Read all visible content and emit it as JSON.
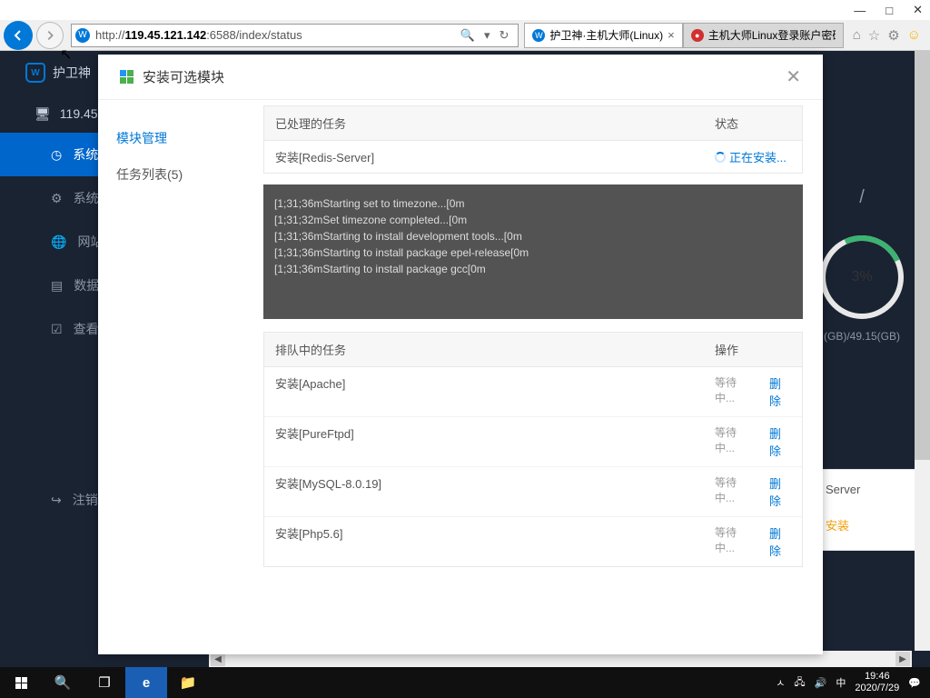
{
  "window": {
    "minimize": "—",
    "maximize": "□",
    "close": "✕"
  },
  "nav": {
    "url_prefix": "http://",
    "url_host": "119.45.121.142",
    "url_rest": ":6588/index/status",
    "search": "🔍",
    "dropdown": "▾",
    "refresh": "↻"
  },
  "tabs": [
    {
      "icon_bg": "#0078d7",
      "icon": "W",
      "label": "护卫神·主机大师(Linux)",
      "close": "×"
    },
    {
      "icon_bg": "#d32f2f",
      "icon": "●",
      "label": "主机大师Linux登录账户密码...",
      "close": ""
    }
  ],
  "nav_icons": {
    "home": "⌂",
    "star": "☆",
    "gear": "⚙",
    "smile": "☺"
  },
  "app": {
    "brand": "护卫神",
    "server_ip": "119.45"
  },
  "sidebar": [
    {
      "icon": "◷",
      "label": "系统"
    },
    {
      "icon": "⚙",
      "label": "系统"
    },
    {
      "icon": "🌐",
      "label": "网站"
    },
    {
      "icon": "▤",
      "label": "数据"
    },
    {
      "icon": "☑",
      "label": "查看"
    },
    {
      "icon": "↪",
      "label": "注销"
    }
  ],
  "gauge": {
    "slash": "/",
    "pct": "3%",
    "disk": "(GB)/49.15(GB)"
  },
  "bg_card": {
    "title": "Server",
    "link": "安装"
  },
  "modal": {
    "title": "安装可选模块",
    "close": "✕",
    "side_link": "模块管理",
    "side_item": "任务列表(5)",
    "processed_header": "已处理的任务",
    "status_header": "状态",
    "processed_row": {
      "name": "安装[Redis-Server]",
      "status": "正在安装..."
    },
    "terminal": [
      "[1;31;36mStarting set to timezone...[0m",
      "[1;31;32mSet timezone completed...[0m",
      "[1;31;36mStarting to install development tools...[0m",
      "[1;31;36mStarting to install package epel-release[0m",
      "[1;31;36mStarting to install package gcc[0m"
    ],
    "queue_header": "排队中的任务",
    "action_header": "操作",
    "queue": [
      {
        "name": "安装[Apache]",
        "wait": "等待中...",
        "del": "删除"
      },
      {
        "name": "安装[PureFtpd]",
        "wait": "等待中...",
        "del": "删除"
      },
      {
        "name": "安装[MySQL-8.0.19]",
        "wait": "等待中...",
        "del": "删除"
      },
      {
        "name": "安装[Php5.6]",
        "wait": "等待中...",
        "del": "删除"
      }
    ]
  },
  "taskbar": {
    "time": "19:46",
    "date": "2020/7/29",
    "ime": "中",
    "notif": "💬",
    "up": "ㅅ",
    "net": "🖧",
    "vol": "🔊"
  }
}
